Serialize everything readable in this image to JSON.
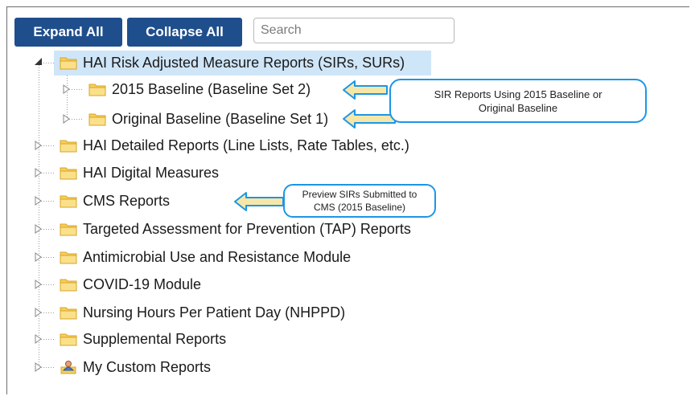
{
  "toolbar": {
    "expand_all_label": "Expand All",
    "collapse_all_label": "Collapse All",
    "search_placeholder": "Search"
  },
  "tree": {
    "items": [
      {
        "label": "HAI Risk Adjusted Measure Reports (SIRs, SURs)",
        "icon": "folder-icon",
        "expanded": true,
        "selected": true
      },
      {
        "label": "2015 Baseline (Baseline Set 2)",
        "icon": "folder-icon"
      },
      {
        "label": "Original Baseline (Baseline Set 1)",
        "icon": "folder-icon"
      },
      {
        "label": "HAI Detailed Reports (Line Lists, Rate Tables, etc.)",
        "icon": "folder-icon"
      },
      {
        "label": "HAI Digital Measures",
        "icon": "folder-icon"
      },
      {
        "label": "CMS Reports",
        "icon": "folder-icon"
      },
      {
        "label": "Targeted Assessment for Prevention (TAP) Reports",
        "icon": "folder-icon"
      },
      {
        "label": "Antimicrobial Use and Resistance Module",
        "icon": "folder-icon"
      },
      {
        "label": "COVID-19 Module",
        "icon": "folder-icon"
      },
      {
        "label": "Nursing Hours Per Patient Day (NHPPD)",
        "icon": "folder-icon"
      },
      {
        "label": "Supplemental Reports",
        "icon": "folder-icon"
      },
      {
        "label": "My Custom Reports",
        "icon": "user-report-icon"
      }
    ]
  },
  "callouts": {
    "sir_line1": "SIR Reports Using 2015 Baseline or",
    "sir_line2": "Original Baseline",
    "cms_line1": "Preview SIRs Submitted to",
    "cms_line2": "CMS (2015 Baseline)"
  },
  "colors": {
    "button_bg": "#1f4e8c",
    "selected_bg": "#cfe5f8",
    "callout_border": "#1c96e6",
    "arrow_fill": "#f6e7a8",
    "arrow_stroke": "#1c96e6",
    "folder": "#f5c542"
  }
}
